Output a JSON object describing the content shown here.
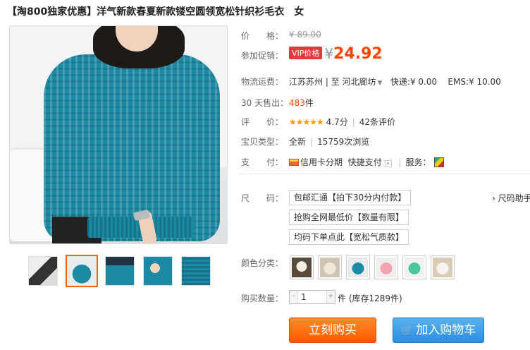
{
  "title": {
    "tag": "【淘800独家优惠】",
    "text": "洋气新款春夏新款镂空圆领宽松针织衫毛衣　女"
  },
  "price": {
    "label": "价　　格：",
    "original": "¥ 89.00"
  },
  "promo": {
    "label": "参加促销：",
    "badge": "VIP价格",
    "currency": "¥",
    "value": "24.92"
  },
  "shipping": {
    "label": "物流运费：",
    "from": "江苏苏州",
    "to_sep": "| 至",
    "to": "河北廊坊",
    "express_label": "快递:",
    "express_value": "¥ 0.00",
    "ems_label": "EMS:",
    "ems_value": "¥ 10.00"
  },
  "sales": {
    "label": "30 天售出：",
    "count": "483",
    "unit": "件"
  },
  "rating": {
    "label": "评　　价：",
    "stars": "★★★★★",
    "score": "4.7分",
    "sep": "|",
    "reviews": "42条评价"
  },
  "item_type": {
    "label": "宝贝类型：",
    "value": "全新",
    "sep": "|",
    "views": "15759次浏览"
  },
  "payment": {
    "label": "支　　付：",
    "credit": "信用卡分期",
    "quick": "快捷支付",
    "service_label": "服务："
  },
  "size": {
    "label": "尺　　码：",
    "options": [
      "包邮汇通【拍下30分内付款】",
      "抢购全网最低价【数量有限】",
      "均码下单点此【宽松气质款】"
    ],
    "help": "尺码助手"
  },
  "color": {
    "label": "颜色分类："
  },
  "quantity": {
    "label": "购买数量：",
    "value": "1",
    "minus": "-",
    "plus": "+",
    "stock": "件 (库存1289件)"
  },
  "buttons": {
    "buy": "立刻购买",
    "cart": "加入购物车"
  },
  "colors": {
    "accent": "#ff4400",
    "buy_button": "#ff5a00",
    "cart_button": "#2a8de0",
    "sweater": "#1d8aa3"
  },
  "icons": {
    "cart": "shopping-cart-icon",
    "credit": "credit-card-icon",
    "service": "service-icon",
    "dropdown": "chevron-down-icon"
  }
}
